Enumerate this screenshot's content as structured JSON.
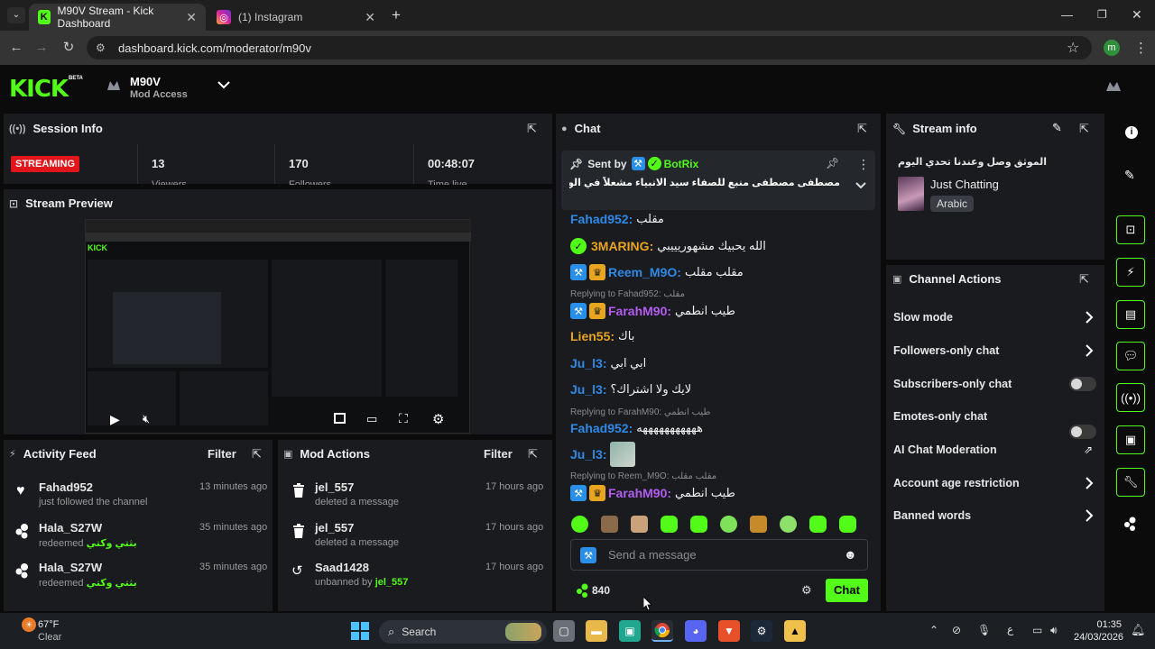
{
  "browser": {
    "tabs": [
      {
        "label": "M90V Stream - Kick Dashboard",
        "active": true
      },
      {
        "label": "(1) Instagram",
        "active": false
      }
    ],
    "url": "dashboard.kick.com/moderator/m90v",
    "profile_initial": "m"
  },
  "header": {
    "logo": "KICK",
    "logo_tag": "BETA",
    "channel_name": "M90V",
    "role": "Mod Access"
  },
  "session": {
    "title": "Session Info",
    "status": "STREAMING",
    "stats": [
      {
        "value": "13",
        "label": "Viewers"
      },
      {
        "value": "170",
        "label": "Followers"
      },
      {
        "value": "00:48:07",
        "label": "Time live"
      }
    ]
  },
  "preview": {
    "title": "Stream Preview"
  },
  "activity": {
    "title": "Activity Feed",
    "filter": "Filter",
    "items": [
      {
        "user": "Fahad952",
        "text": "just followed the channel",
        "extra": "",
        "time": "13 minutes ago",
        "icon": "heart-icon"
      },
      {
        "user": "Hala_S27W",
        "text": "redeemed",
        "extra": "بثتي وكتي",
        "time": "35 minutes ago",
        "icon": "kick-points-icon"
      },
      {
        "user": "Hala_S27W",
        "text": "redeemed",
        "extra": "بثتي وكتي",
        "time": "35 minutes ago",
        "icon": "kick-points-icon"
      }
    ]
  },
  "modactions": {
    "title": "Mod Actions",
    "filter": "Filter",
    "items": [
      {
        "user": "jel_557",
        "text": "deleted a message",
        "extra": "",
        "time": "17 hours ago",
        "icon": "trash-icon"
      },
      {
        "user": "jel_557",
        "text": "deleted a message",
        "extra": "",
        "time": "17 hours ago",
        "icon": "trash-icon"
      },
      {
        "user": "Saad1428",
        "text": "unbanned by",
        "extra": "jel_557",
        "time": "17 hours ago",
        "icon": "undo-icon"
      }
    ]
  },
  "chat": {
    "title": "Chat",
    "pinned": {
      "sent_by": "Sent by",
      "bot": "BotRix",
      "text": "مصطفى مصطفى منبع للصفاء سيد الانبياء مشعلاً في الوفاء كان في عطفهم"
    },
    "messages": [
      {
        "user": "Fahad952",
        "color": "#2e8ae6",
        "badges": [],
        "text": "مقلب",
        "reply": ""
      },
      {
        "user": "3MARING",
        "color": "#e8a51f",
        "badges": [
          "ver"
        ],
        "text": "الله يحبيك مشهوريييبي",
        "reply": ""
      },
      {
        "user": "Reem_M9O",
        "color": "#2e8ae6",
        "badges": [
          "mod",
          "vip"
        ],
        "text": "مقلب مقلب",
        "reply": ""
      },
      {
        "user": "FarahM90",
        "color": "#b35cf0",
        "badges": [
          "mod",
          "vip"
        ],
        "text": "طيب انطمي",
        "reply": "Replying to Fahad952: مقلب"
      },
      {
        "user": "Lien55",
        "color": "#e8a51f",
        "badges": [],
        "text": "باك",
        "reply": ""
      },
      {
        "user": "Ju_l3",
        "color": "#2e8ae6",
        "badges": [],
        "text": "ابي ابي",
        "reply": ""
      },
      {
        "user": "Ju_l3",
        "color": "#2e8ae6",
        "badges": [],
        "text": "لايك ولا اشتراك؟",
        "reply": ""
      },
      {
        "user": "Fahad952",
        "color": "#2e8ae6",
        "badges": [],
        "text": "هههههههههههه",
        "reply": "Replying to FarahM90: طيب انطمي"
      },
      {
        "user": "Ju_l3",
        "color": "#2e8ae6",
        "badges": [],
        "text": "",
        "reply": ""
      },
      {
        "user": "FarahM90",
        "color": "#b35cf0",
        "badges": [
          "mod",
          "vip"
        ],
        "text": "طيب انطمي",
        "reply": "Replying to Reem_M9O: مقلب مقلب"
      }
    ],
    "input_placeholder": "Send a message",
    "points": "840",
    "send_label": "Chat"
  },
  "streaminfo": {
    "title": "Stream info",
    "stream_title": "الموثق وصل وعندنا تحدي اليوم",
    "category": "Just Chatting",
    "tag": "Arabic"
  },
  "channel_actions": {
    "title": "Channel Actions",
    "items": [
      {
        "label": "Slow mode",
        "control": "chevron"
      },
      {
        "label": "Followers-only chat",
        "control": "chevron"
      },
      {
        "label": "Subscribers-only chat",
        "control": "toggle"
      },
      {
        "label": "Emotes-only chat",
        "control": "toggle"
      },
      {
        "label": "AI Chat Moderation",
        "control": "external"
      },
      {
        "label": "Account age restriction",
        "control": "chevron"
      },
      {
        "label": "Banned words",
        "control": "chevron"
      }
    ]
  },
  "taskbar": {
    "weather_temp": "67°F",
    "weather_desc": "Clear",
    "search": "Search",
    "time": "01:35",
    "date": "24/03/2026",
    "lang": "ع"
  },
  "colors": {
    "accent": "#53fc18",
    "panel": "#191b1f",
    "streaming": "#e1161b"
  }
}
